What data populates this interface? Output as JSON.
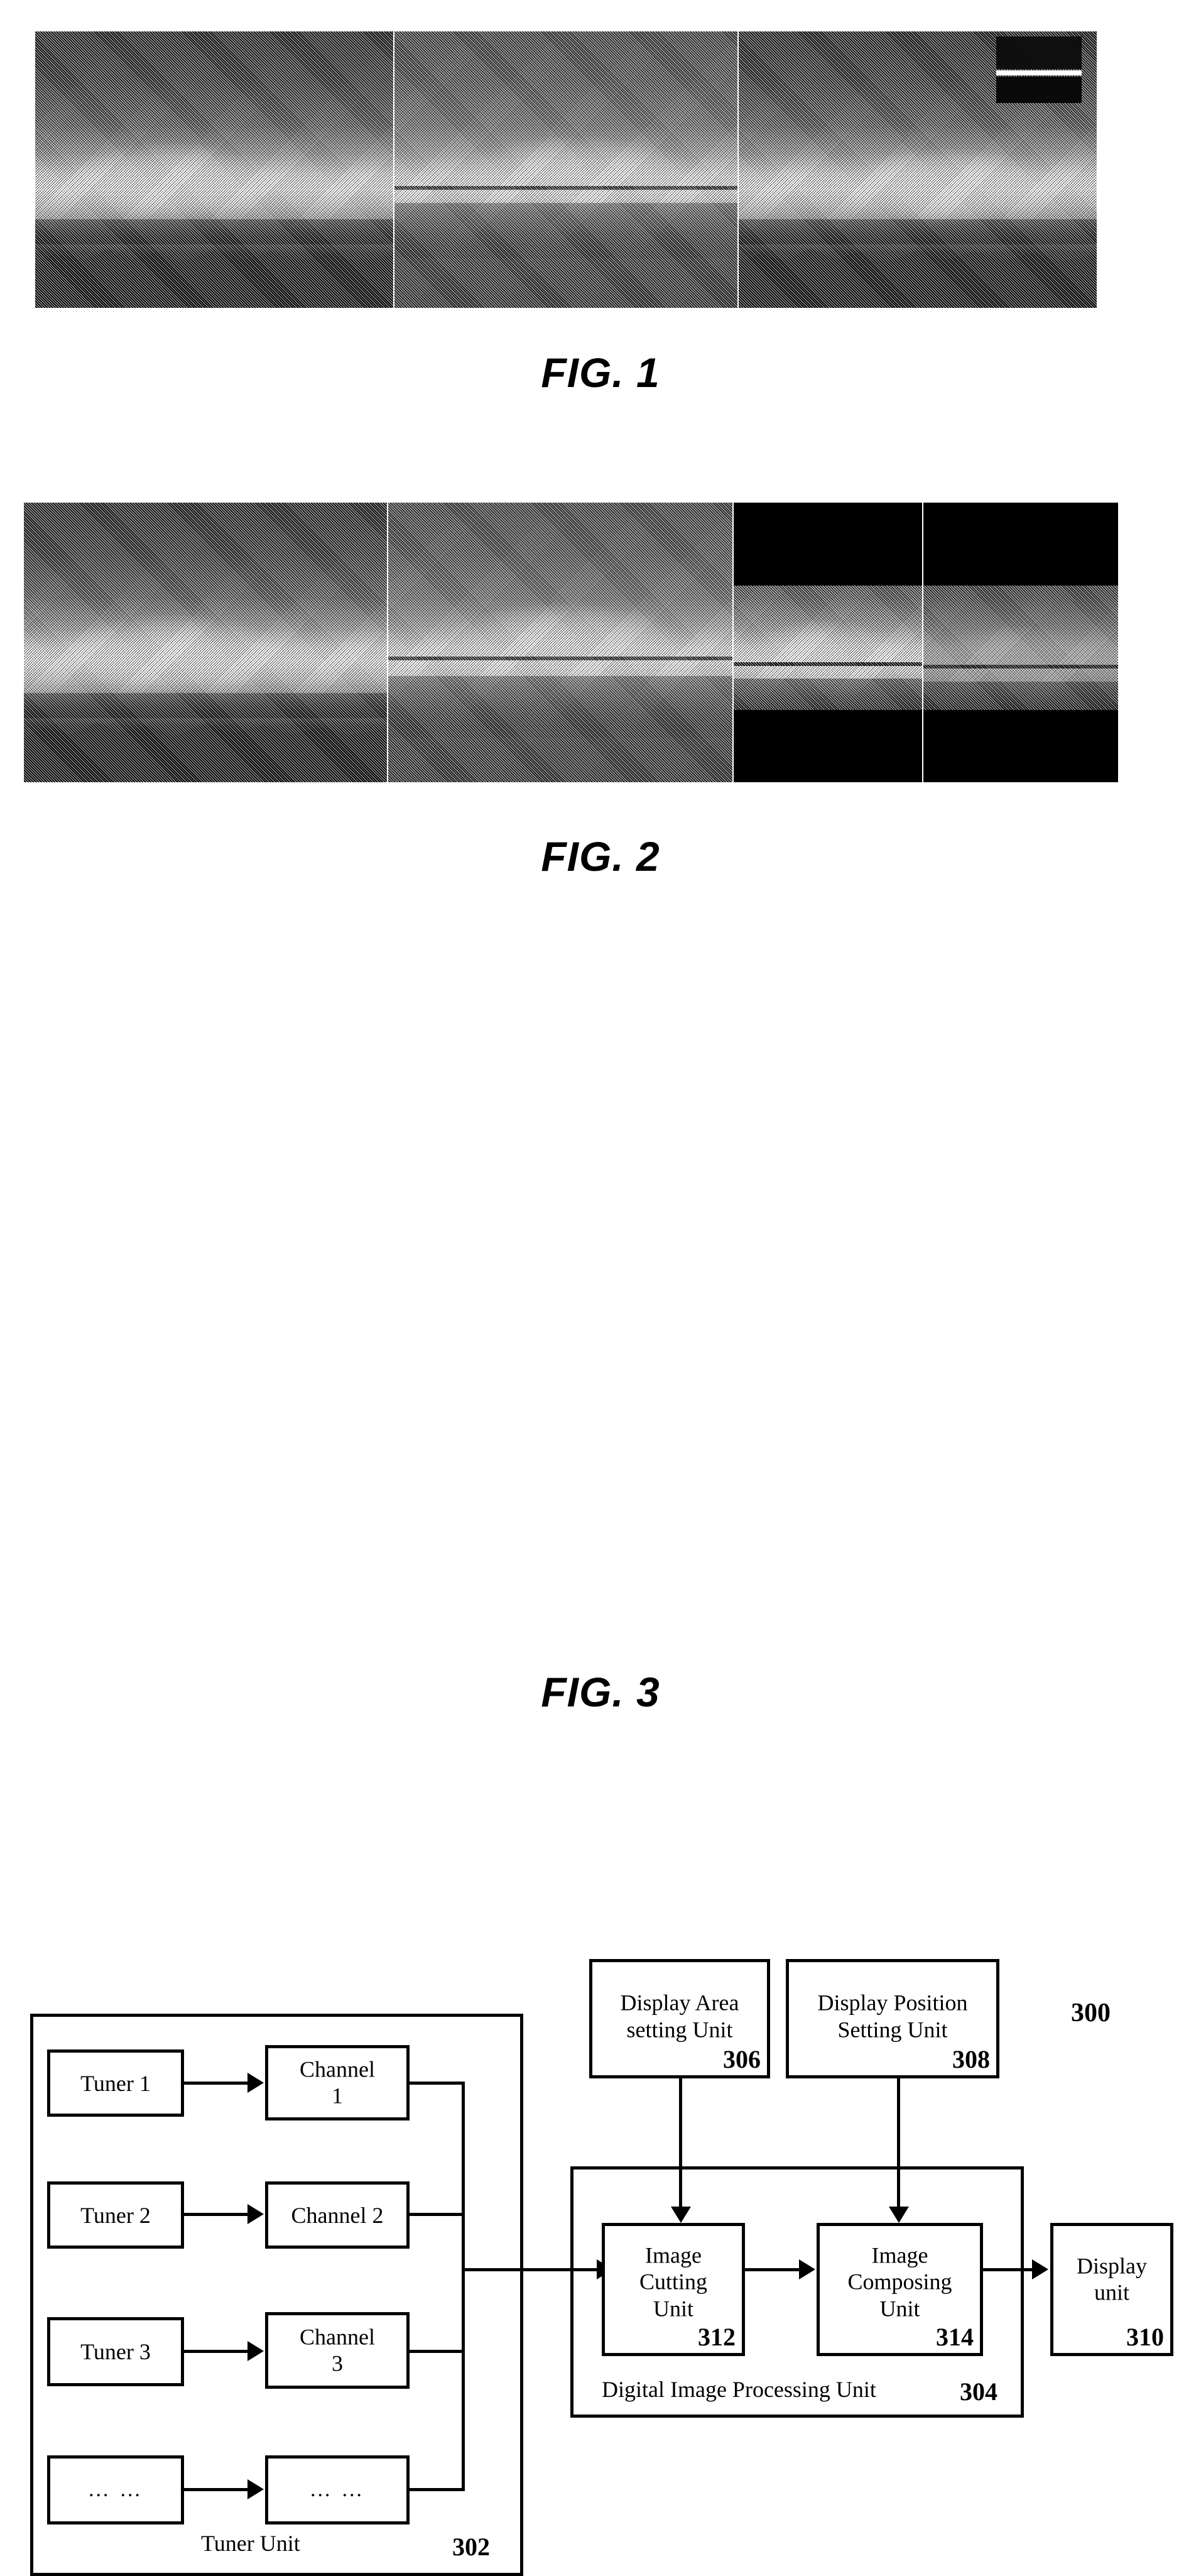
{
  "figures": [
    {
      "id": "fig1",
      "label": "FIG. 1",
      "caption_position": "below",
      "description": "Halftone-printed wide sunset/horizon photograph split into three side-by-side panels of differing brightness, with a small dark rectangular overlay badge near the upper right."
    },
    {
      "id": "fig2",
      "label": "FIG. 2",
      "caption_position": "below",
      "description": "Halftone-printed wide sunset/horizon photograph split into four panels; the rightmost region has a solid black block across its top."
    },
    {
      "id": "fig3",
      "label": "FIG. 3",
      "caption_position": "below",
      "description": "Block diagram of a multi-tuner digital image processing and display system."
    }
  ],
  "fig3": {
    "system_ref": "300",
    "tuner_unit": {
      "label": "Tuner Unit",
      "ref": "302",
      "rows": [
        {
          "tuner": "Tuner 1",
          "channel": "Channel\n1"
        },
        {
          "tuner": "Tuner 2",
          "channel": "Channel 2"
        },
        {
          "tuner": "Tuner 3",
          "channel": "Channel\n3"
        },
        {
          "tuner": "… …",
          "channel": "… …"
        }
      ]
    },
    "setting_units": [
      {
        "label": "Display Area\nsetting Unit",
        "ref": "306"
      },
      {
        "label": "Display Position\nSetting Unit",
        "ref": "308"
      }
    ],
    "processing_unit": {
      "label": "Digital Image Processing Unit",
      "ref": "304",
      "blocks": [
        {
          "label": "Image\nCutting\nUnit",
          "ref": "312"
        },
        {
          "label": "Image\nComposing\nUnit",
          "ref": "314"
        }
      ]
    },
    "display_unit": {
      "label": "Display\nunit",
      "ref": "310"
    }
  },
  "colors": {
    "ink": "#000000",
    "paper": "#ffffff"
  }
}
